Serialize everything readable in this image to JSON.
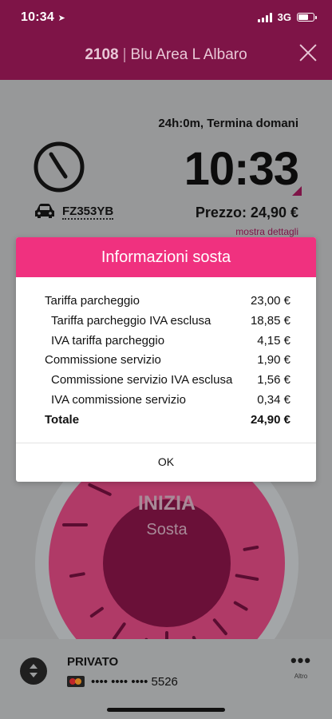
{
  "status_bar": {
    "time": "10:34",
    "network": "3G",
    "signal_bars": 4,
    "battery_level": 0.7
  },
  "header": {
    "zone_code": "2108",
    "separator": "|",
    "zone_name": "Blu Area L Albaro"
  },
  "parking": {
    "duration_text": "24h:0m, Termina domani",
    "end_time": "10:33",
    "plate": "FZ353YB",
    "price_text": "Prezzo: 24,90 €",
    "details_link": "mostra dettagli"
  },
  "dial": {
    "action_label": "INIZIA",
    "action_sub": "Sosta"
  },
  "account": {
    "type": "PRIVATO",
    "card_number": "•••• •••• •••• 5526",
    "more_label": "Altro"
  },
  "modal": {
    "title": "Informazioni sosta",
    "rows": [
      {
        "label": "Tariffa parcheggio",
        "value": "23,00 €"
      },
      {
        "label": "Tariffa parcheggio IVA esclusa",
        "value": "18,85 €"
      },
      {
        "label": "IVA tariffa parcheggio",
        "value": "4,15 €"
      },
      {
        "label": "Commissione servizio",
        "value": "1,90 €"
      },
      {
        "label": "Commissione servizio IVA esclusa",
        "value": "1,56 €"
      },
      {
        "label": "IVA commissione servizio",
        "value": "0,34 €"
      },
      {
        "label": "Totale",
        "value": "24,90 €"
      }
    ],
    "ok_label": "OK"
  },
  "colors": {
    "brand_dark": "#7e1447",
    "brand_pink": "#f0317f",
    "dial_pink": "#d9266a",
    "overlay_gray": "#979899"
  }
}
